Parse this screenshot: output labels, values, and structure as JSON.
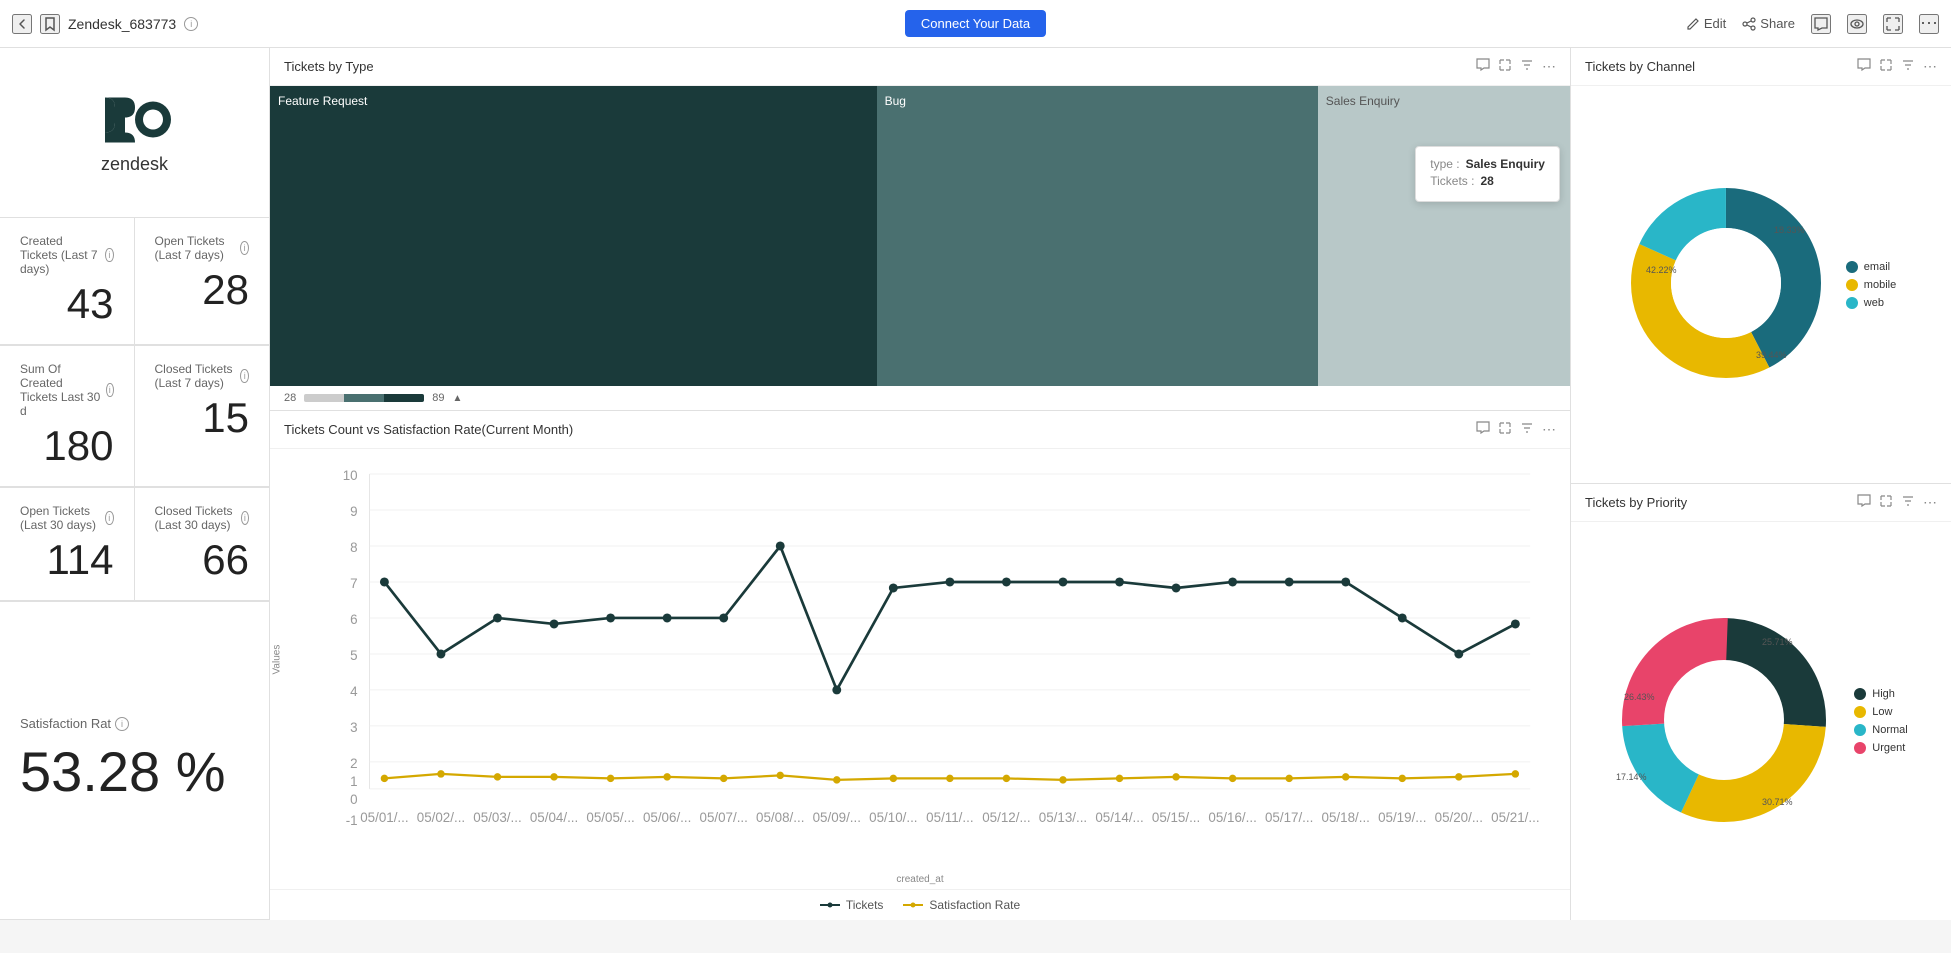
{
  "topbar": {
    "back_icon": "←",
    "star_icon": "☆",
    "title": "Zendesk_683773",
    "info_icon": "ⓘ",
    "connect_btn": "Connect Your Data",
    "edit_label": "Edit",
    "share_label": "Share",
    "comment_icon": "💬",
    "glasses_icon": "👓",
    "expand_icon": "⤢",
    "more_icon": "⋯"
  },
  "left": {
    "zendesk_text": "zendesk",
    "cards": [
      {
        "label": "Created Tickets (Last 7 days)",
        "value": "43",
        "has_info": true
      },
      {
        "label": "Sum Of Created Tickets Last 30 d",
        "value": "180",
        "has_info": true
      },
      {
        "label": "Open Tickets (Last 7 days)",
        "value": "28",
        "has_info": true
      },
      {
        "label": "Open Tickets (Last 30 days)",
        "value": "114",
        "has_info": true
      },
      {
        "label": "Closed Tickets (Last 7 days)",
        "value": "15",
        "has_info": true
      },
      {
        "label": "Closed Tickets (Last 30 days)",
        "value": "66",
        "has_info": true
      },
      {
        "label": "Satisfaction Rat",
        "value": "53.28 %",
        "has_info": true,
        "is_satisfaction": true
      }
    ]
  },
  "tickets_by_type": {
    "title": "Tickets by Type",
    "cells": [
      {
        "label": "Feature Request",
        "color": "#1a3a3a",
        "flex": 2.5
      },
      {
        "label": "Bug",
        "color": "#4a7070",
        "flex": 1.8
      },
      {
        "label": "Sales Enquiry",
        "color": "#b8c8c8",
        "flex": 1,
        "dark_text": true
      }
    ],
    "tooltip": {
      "type_label": "type :",
      "type_value": "Sales Enquiry",
      "tickets_label": "Tickets :",
      "tickets_value": "28"
    },
    "legend_min": "28",
    "legend_max": "89"
  },
  "chart": {
    "title": "Tickets Count vs Satisfaction Rate(Current Month)",
    "y_label": "Values",
    "x_label": "created_at",
    "y_ticks": [
      "10",
      "9",
      "8",
      "7",
      "6",
      "5",
      "4",
      "3",
      "2",
      "1",
      "0",
      "-1"
    ],
    "x_ticks": [
      "05/01/...",
      "05/02/...",
      "05/03/...",
      "05/04/...",
      "05/05/...",
      "05/06/...",
      "05/07/...",
      "05/08/...",
      "05/09/...",
      "05/10/...",
      "05/11/...",
      "05/12/...",
      "05/13/...",
      "05/14/...",
      "05/15/...",
      "05/16/...",
      "05/17/...",
      "05/18/...",
      "05/19/...",
      "05/20/...",
      "05/21/..."
    ],
    "legend": [
      {
        "label": "Tickets",
        "color": "#1a3a3a"
      },
      {
        "label": "Satisfaction Rate",
        "color": "#d4a800"
      }
    ]
  },
  "tickets_by_channel": {
    "title": "Tickets by Channel",
    "segments": [
      {
        "label": "email",
        "color": "#1a6b7c",
        "pct": "42.22%",
        "angle": 152
      },
      {
        "label": "mobile",
        "color": "#e8b800",
        "pct": "39.44%",
        "angle": 142
      },
      {
        "label": "web",
        "color": "#29b6c8",
        "pct": "18.33%",
        "angle": 66
      }
    ]
  },
  "tickets_by_priority": {
    "title": "Tickets by Priority",
    "segments": [
      {
        "label": "High",
        "color": "#1a3a3a",
        "pct": "25.71%",
        "angle": 92
      },
      {
        "label": "Low",
        "color": "#e8b800",
        "pct": "30.71%",
        "angle": 110
      },
      {
        "label": "Normal",
        "color": "#29b6c8",
        "pct": "17.14%",
        "angle": 62
      },
      {
        "label": "Urgent",
        "color": "#e8446a",
        "pct": "26.43%",
        "angle": 95
      }
    ]
  }
}
